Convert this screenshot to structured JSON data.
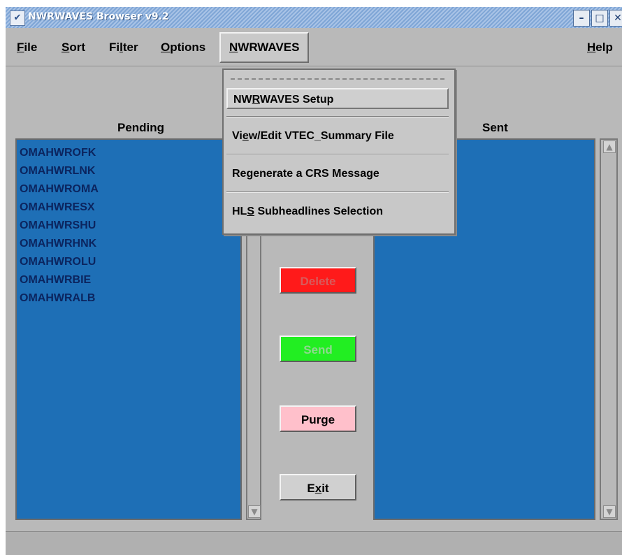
{
  "window": {
    "title": "NWRWAVES Browser v9.2",
    "logo_glyph": "✔",
    "minimize_glyph": "–",
    "maximize_glyph": "□",
    "close_glyph": "✕"
  },
  "menubar": {
    "file": {
      "mn": "F",
      "rest": "ile"
    },
    "sort": {
      "mn": "S",
      "rest": "ort"
    },
    "filter": {
      "pre": "Fi",
      "mn": "l",
      "rest": "ter"
    },
    "options": {
      "mn": "O",
      "rest": "ptions"
    },
    "nwrwaves": {
      "mn": "N",
      "rest": "WRWAVES"
    },
    "help": {
      "mn": "H",
      "rest": "elp"
    }
  },
  "dropdown": {
    "tearoff": "- - - - - - - - - - - - - - - - -",
    "items": [
      {
        "pre": "NW",
        "mn": "R",
        "rest": "WAVES Setup"
      },
      {
        "pre": "Vi",
        "mn": "e",
        "rest": "w/Edit VTEC_Summary File"
      },
      {
        "pre": "Regenerate a CRS Message",
        "mn": "",
        "rest": ""
      },
      {
        "pre": "HL",
        "mn": "S",
        "rest": " Subheadlines Selection"
      }
    ]
  },
  "pending": {
    "header": "Pending",
    "items": [
      "OMAHWROFK",
      "OMAHWRLNK",
      "OMAHWROMA",
      "OMAHWRESX",
      "OMAHWRSHU",
      "OMAHWRHNK",
      "OMAHWROLU",
      "OMAHWRBIE",
      "OMAHWRALB"
    ]
  },
  "sent": {
    "header": "Sent",
    "items": []
  },
  "buttons": {
    "delete": "Delete",
    "send": "Send",
    "purge": "Purge",
    "exit": {
      "pre": "E",
      "mn": "x",
      "rest": "it"
    }
  },
  "colors": {
    "list_bg": "#1e6fb6",
    "list_text": "#0b245e",
    "delete_bg": "#ff1a1a",
    "send_bg": "#22ee22",
    "purge_bg": "#ffc0cb",
    "exit_bg": "#d0d0d0",
    "yellow_bg": "#e8e600"
  }
}
